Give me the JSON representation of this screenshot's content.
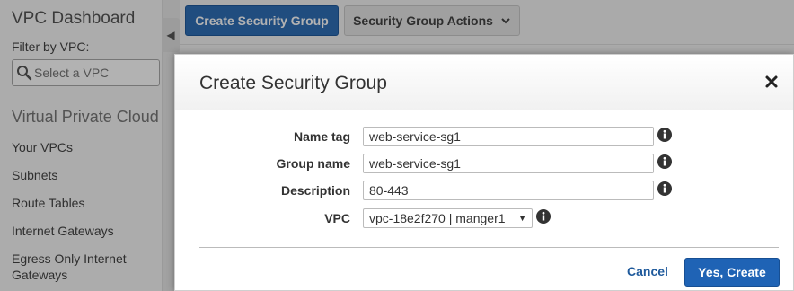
{
  "sidebar": {
    "title": "VPC Dashboard",
    "filter_label": "Filter by VPC:",
    "vpc_select_placeholder": "Select a VPC",
    "section_title": "Virtual Private Cloud",
    "items": [
      {
        "label": "Your VPCs"
      },
      {
        "label": "Subnets"
      },
      {
        "label": "Route Tables"
      },
      {
        "label": "Internet Gateways"
      },
      {
        "label": "Egress Only Internet Gateways"
      }
    ]
  },
  "toolbar": {
    "create_label": "Create Security Group",
    "actions_label": "Security Group Actions"
  },
  "modal": {
    "title": "Create Security Group",
    "fields": {
      "name_tag": {
        "label": "Name tag",
        "value": "web-service-sg1"
      },
      "group_name": {
        "label": "Group name",
        "value": "web-service-sg1"
      },
      "description": {
        "label": "Description",
        "value": "80-443"
      },
      "vpc": {
        "label": "VPC",
        "value": "vpc-18e2f270 | manger1"
      }
    },
    "cancel_label": "Cancel",
    "confirm_label": "Yes, Create"
  },
  "colors": {
    "primary": "#1f63b5",
    "link": "#1f5a9c"
  }
}
